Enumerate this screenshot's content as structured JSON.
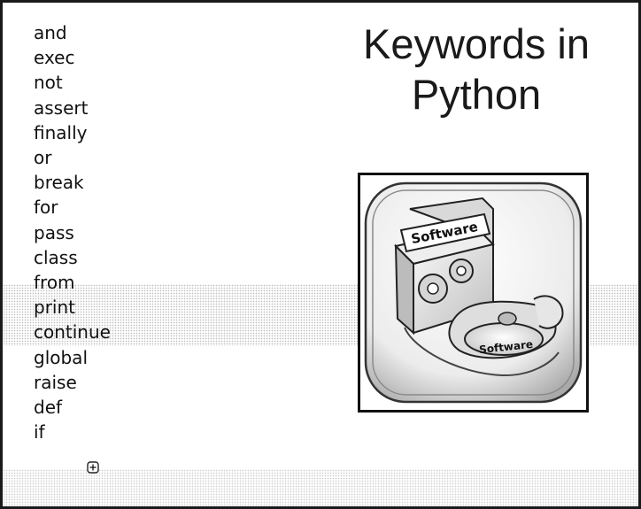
{
  "slide": {
    "title": "Keywords in\nPython",
    "keywords": [
      "and",
      "exec",
      "not",
      "assert",
      "finally",
      "or",
      "break",
      "for",
      "pass",
      "class",
      "from",
      "print",
      "continue",
      "global",
      "raise",
      "def",
      "if"
    ],
    "clipart": {
      "box_label": "Software",
      "disc_label": "Software"
    },
    "add_icon": "plus-square-icon"
  }
}
